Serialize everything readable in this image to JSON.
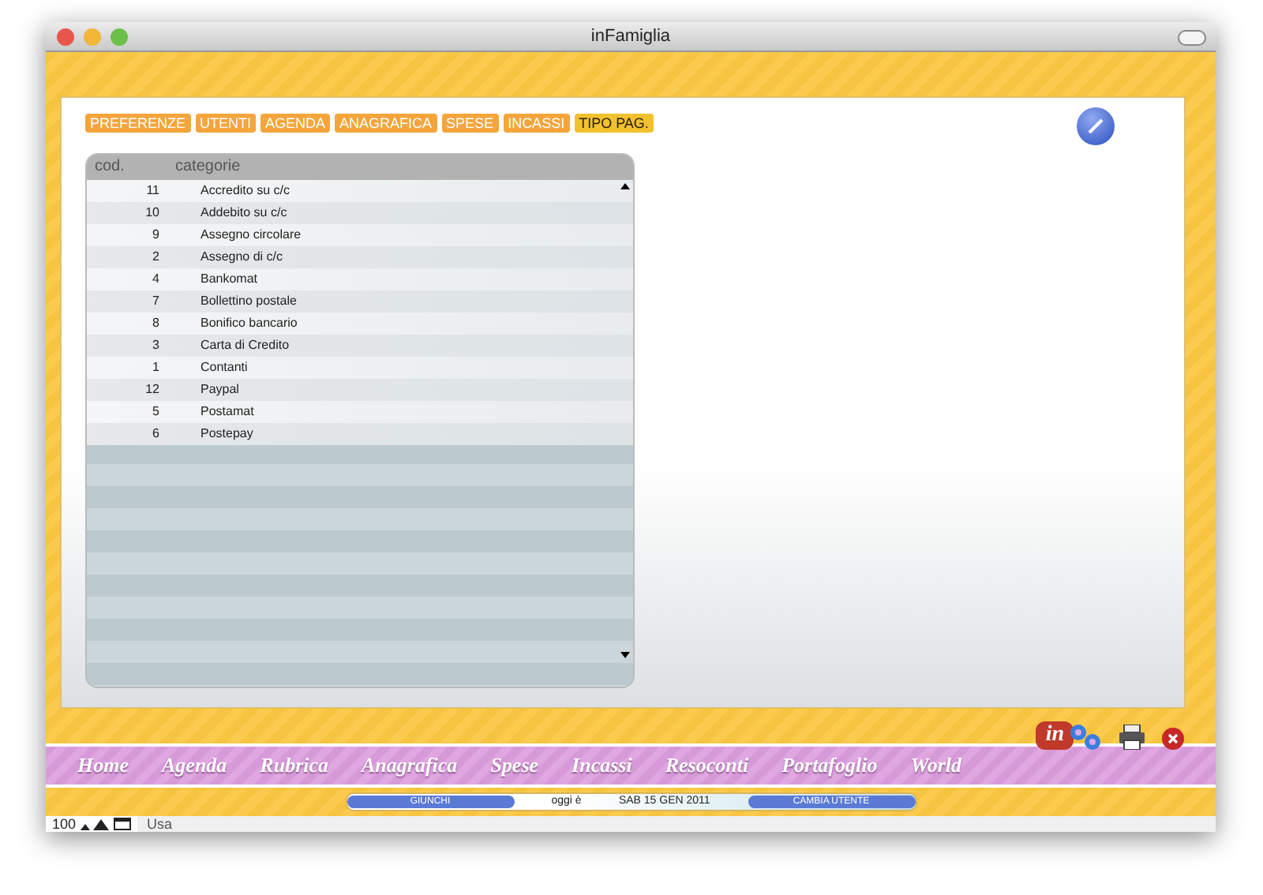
{
  "window": {
    "title": "inFamiglia"
  },
  "tabs": [
    {
      "label": "PREFERENZE",
      "selected": false
    },
    {
      "label": "UTENTI",
      "selected": false
    },
    {
      "label": "AGENDA",
      "selected": false
    },
    {
      "label": "ANAGRAFICA",
      "selected": false
    },
    {
      "label": "SPESE",
      "selected": false
    },
    {
      "label": "INCASSI",
      "selected": false
    },
    {
      "label": "TIPO PAG.",
      "selected": true
    }
  ],
  "table": {
    "columns": [
      "cod.",
      "categorie"
    ],
    "rows": [
      [
        "11",
        "Accredito su c/c"
      ],
      [
        "10",
        "Addebito su c/c"
      ],
      [
        "9",
        "Assegno circolare"
      ],
      [
        "2",
        "Assegno di c/c"
      ],
      [
        "4",
        "Bankomat"
      ],
      [
        "7",
        "Bollettino postale"
      ],
      [
        "8",
        "Bonifico bancario"
      ],
      [
        "3",
        "Carta di Credito"
      ],
      [
        "1",
        "Contanti"
      ],
      [
        "12",
        "Paypal"
      ],
      [
        "5",
        "Postamat"
      ],
      [
        "6",
        "Postepay"
      ]
    ]
  },
  "nav": [
    "Home",
    "Agenda",
    "Rubrica",
    "Anagrafica",
    "Spese",
    "Incassi",
    "Resoconti",
    "Portafoglio",
    "World"
  ],
  "logo_badge": "in",
  "status": {
    "user": "GIUNCHI",
    "today_label": "oggi è",
    "date": "SAB 15 GEN 2011",
    "switch_user": "CAMBIA UTENTE"
  },
  "footer": {
    "zoom": "100",
    "mode": "Usa"
  }
}
